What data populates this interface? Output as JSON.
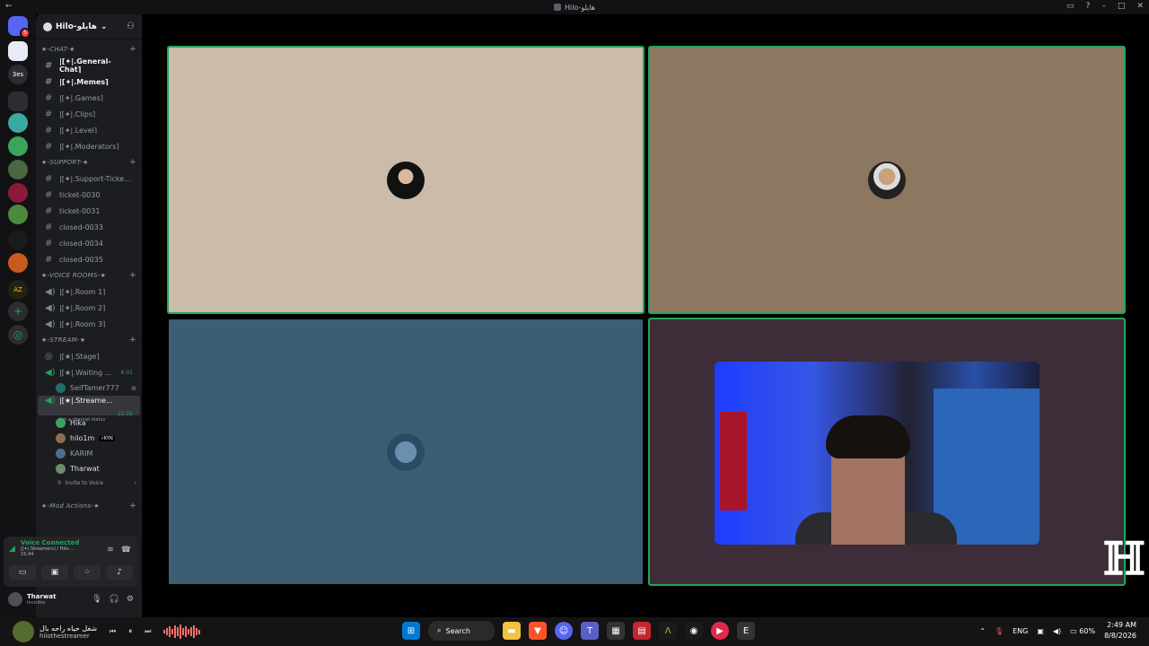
{
  "window": {
    "title": "Hilo-هايلو"
  },
  "server": {
    "name": "Hilo-هايلو"
  },
  "categories": {
    "chat": "★-CHAT-★",
    "support": "★-SUPPORT-★",
    "voice": "★-VOICE ROOMS-★",
    "stream": "★-STREAM-★",
    "mod": "★-Mod Actions-★"
  },
  "chat_channels": [
    {
      "label": "|[✦|.General-Chat⌉",
      "bold": true
    },
    {
      "label": "|[✦|.Memes⌉",
      "bold": true
    },
    {
      "label": "|[✦|.Games⌉",
      "bold": false
    },
    {
      "label": "|[✦|.Clips⌉",
      "bold": false
    },
    {
      "label": "|[✦|.Level⌉",
      "bold": false
    },
    {
      "label": "|[✦|.Moderators⌉",
      "bold": false
    }
  ],
  "support_channels": [
    "|[✦|.Support-Ticke...",
    "ticket-0030",
    "ticket-0031",
    "closed-0033",
    "closed-0034",
    "closed-0035"
  ],
  "voice_rooms": [
    "|[✦|.Room 1⌉",
    "|[✦|.Room 2⌉",
    "|[✦|.Room 3⌉"
  ],
  "stream_channels": {
    "stage": "|[★|.Stage⌉",
    "waiting": "|[★|.Waiting ...",
    "waiting_time": "8:01",
    "waiting_user": "SeifTamer777",
    "streamers": "|[★|.Streame...",
    "streamers_time": "22:22",
    "streamers_status": "Set a channel status"
  },
  "voice_users": [
    {
      "name": "Hika",
      "tag": "",
      "dim": false
    },
    {
      "name": "hilo1m",
      "tag": "⚡KYN",
      "dim": false
    },
    {
      "name": "KARIM",
      "tag": "",
      "dim": true
    },
    {
      "name": "Tharwat",
      "tag": "",
      "dim": false
    }
  ],
  "invite_label": "Invite to Voice",
  "voice_panel": {
    "status": "Voice Connected",
    "channel": "|[✦|.Streamers⌉ / Hilo-...",
    "time": "15:44"
  },
  "user": {
    "name": "Tharwat",
    "status": "Invisible"
  },
  "media": {
    "song": "شغل حياه راحه بال",
    "artist": "hilothestreamer"
  },
  "taskbar": {
    "search_label": "Search",
    "lang": "ENG",
    "battery": "60%",
    "time": "2:49 AM",
    "date": "8/8/2026"
  },
  "colors": {
    "accent": "#23a559",
    "tile1": "#cbbcaa",
    "tile2": "#8c7761",
    "tile3": "#3c5e72",
    "tile4": "#3d2d38"
  }
}
